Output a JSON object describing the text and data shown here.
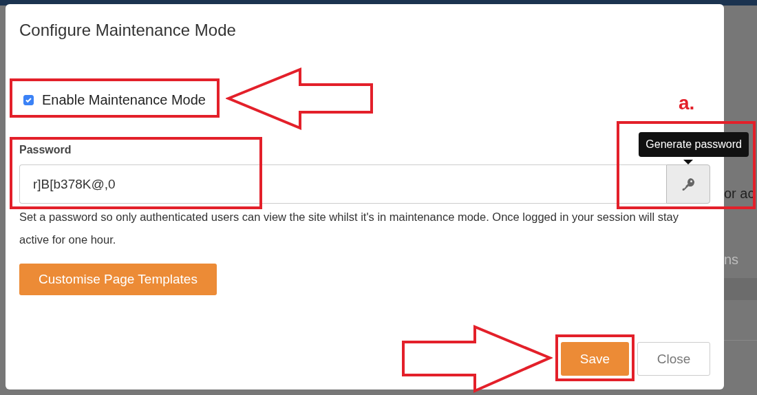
{
  "background_page": {
    "texts": [
      "or ac",
      "ns"
    ]
  },
  "dialog": {
    "title": "Configure Maintenance Mode",
    "enable_checkbox": {
      "label": "Enable Maintenance Mode",
      "checked": true
    },
    "password": {
      "label": "Password",
      "value": "r]B[b378K@,0",
      "tooltip": "Generate password"
    },
    "help_text": "Set a password so only authenticated users can view the site whilst it's in maintenance mode. Once logged in your session will stay active for one hour.",
    "customise_button": "Customise Page Templates",
    "buttons": [
      {
        "label": "Save",
        "kind": "primary"
      },
      {
        "label": "Close",
        "kind": "secondary"
      }
    ]
  },
  "annotations": {
    "label": "a."
  }
}
